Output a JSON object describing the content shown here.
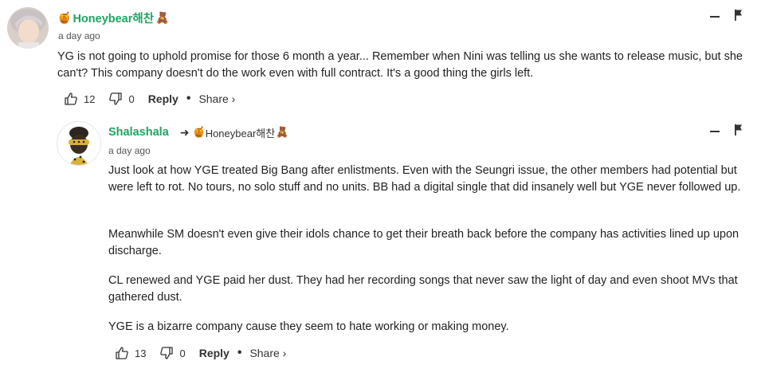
{
  "comment": {
    "username": "Honeybear해찬",
    "timestamp": "a day ago",
    "text": "YG is not going to uphold promise for those 6 month a year... Remember when Nini was telling us she wants to release music, but she can't? This company doesn't do the work even with full contract. It's a good thing the girls left.",
    "likes": "12",
    "dislikes": "0",
    "reply_label": "Reply",
    "share_label": "Share ›"
  },
  "reply": {
    "username": "Shalashala",
    "replying_to": "Honeybear해찬",
    "timestamp": "a day ago",
    "paragraphs": [
      "Just look at how YGE treated Big Bang after enlistments. Even with the Seungri issue, the other members had potential but were left to rot. No tours, no solo stuff and no units. BB had a digital single that did insanely well but YGE never followed up.",
      "Meanwhile SM doesn't even give their idols chance to get their breath back before the company has activities lined up upon discharge.",
      "CL renewed and YGE paid her dust. They had her recording songs that never saw the light of day and even shoot MVs that gathered dust.",
      "YGE is a bizarre company cause they seem to hate working or making money."
    ],
    "likes": "13",
    "dislikes": "0",
    "reply_label": "Reply",
    "share_label": "Share ›"
  },
  "icons": {
    "badge": "honey-pot-emoji",
    "bear": "bear-emoji",
    "collapse": "minus-icon",
    "flag": "flag-icon",
    "like": "thumbs-up-icon",
    "dislike": "thumbs-down-icon",
    "reply_arrow": "reply-arrow-icon"
  },
  "colors": {
    "username": "#1fa463",
    "text": "#222222"
  }
}
